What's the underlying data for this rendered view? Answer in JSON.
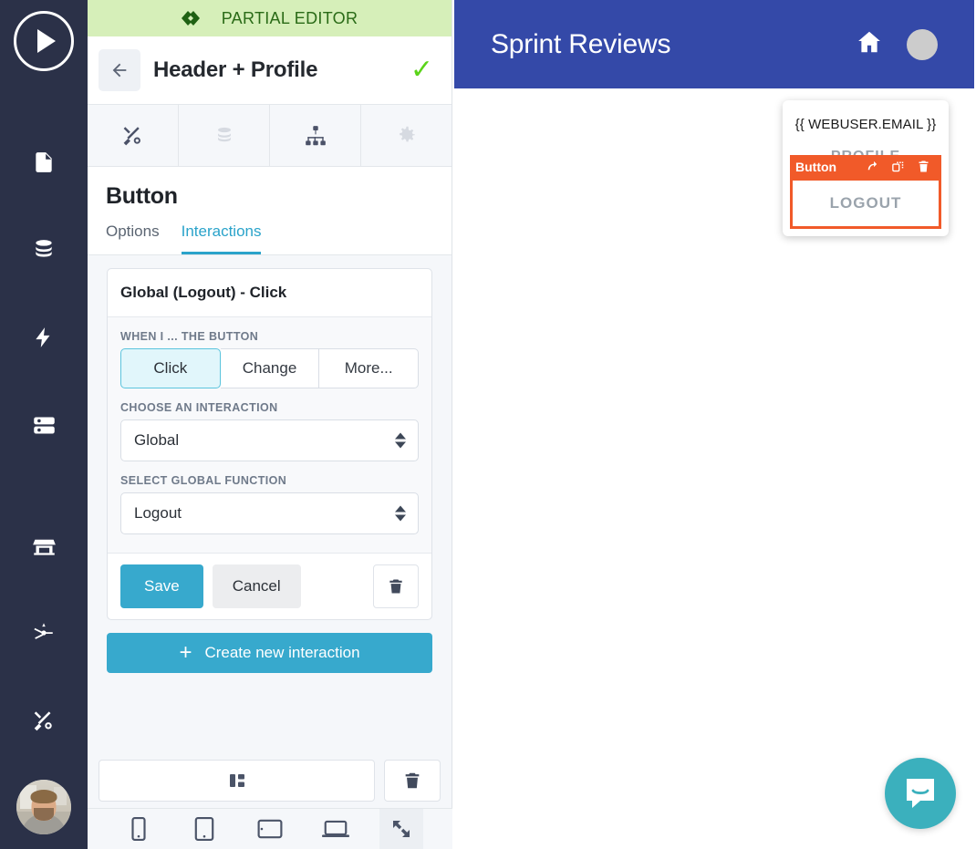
{
  "rail": {
    "logo_icon": "play-circle-icon",
    "items": [
      {
        "icon": "page-icon",
        "name": "pages"
      },
      {
        "icon": "database-icon",
        "name": "data"
      },
      {
        "icon": "lightning-icon",
        "name": "actions"
      },
      {
        "icon": "server-icon",
        "name": "servers"
      },
      {
        "icon": "storefront-icon",
        "name": "marketplace"
      },
      {
        "icon": "share-icon",
        "name": "integrations"
      },
      {
        "icon": "tools-icon",
        "name": "settings"
      }
    ],
    "avatar_name": "user-avatar"
  },
  "editor": {
    "banner": {
      "label": "PARTIAL EDITOR",
      "icon": "partial-diamond-icon"
    },
    "title": "Header + Profile",
    "back_icon": "arrow-left-icon",
    "saved_icon": "check-icon",
    "tabs": [
      {
        "icon": "tools-icon",
        "name": "build",
        "active": true
      },
      {
        "icon": "database-icon",
        "name": "data",
        "active": false
      },
      {
        "icon": "sitemap-icon",
        "name": "structure",
        "active": true
      },
      {
        "icon": "gear-icon",
        "name": "settings",
        "active": false
      }
    ],
    "component_name": "Button",
    "sub_tabs": [
      {
        "label": "Options",
        "active": false
      },
      {
        "label": "Interactions",
        "active": true
      }
    ],
    "interaction": {
      "card_title": "Global (Logout) - Click",
      "trigger_label": "WHEN I ... THE BUTTON",
      "triggers": [
        {
          "label": "Click",
          "selected": true
        },
        {
          "label": "Change",
          "selected": false
        },
        {
          "label": "More...",
          "selected": false
        }
      ],
      "interaction_label": "CHOOSE AN INTERACTION",
      "interaction_value": "Global",
      "interaction_options": [
        "Global"
      ],
      "function_label": "SELECT GLOBAL FUNCTION",
      "function_value": "Logout",
      "function_options": [
        "Logout"
      ],
      "save_label": "Save",
      "cancel_label": "Cancel",
      "delete_icon": "trash-icon"
    },
    "create_label": "Create new interaction",
    "create_plus": "+",
    "bottom": {
      "layout_icon": "layout-columns-icon",
      "delete_icon": "trash-icon"
    },
    "devices": [
      {
        "icon": "mobile-icon",
        "name": "mobile",
        "active": false
      },
      {
        "icon": "tablet-portrait-icon",
        "name": "tablet-portrait",
        "active": false
      },
      {
        "icon": "tablet-landscape-icon",
        "name": "tablet-landscape",
        "active": false
      },
      {
        "icon": "laptop-icon",
        "name": "laptop",
        "active": false
      },
      {
        "icon": "expand-icon",
        "name": "fullscreen",
        "active": true
      }
    ]
  },
  "preview": {
    "app_bar": {
      "title": "Sprint Reviews",
      "home_icon": "home-icon",
      "avatar": "user-avatar-circle",
      "background": "#3449a8"
    },
    "popup": {
      "email": "{{ WEBUSER.EMAIL }}",
      "profile_label": "PROFILE",
      "selection": {
        "name": "Button",
        "color": "#f15a29",
        "icons": [
          {
            "icon": "move-arrow-icon",
            "name": "move"
          },
          {
            "icon": "duplicate-icon",
            "name": "duplicate"
          },
          {
            "icon": "trash-icon",
            "name": "delete"
          }
        ]
      },
      "logout_label": "LOGOUT"
    },
    "chat_icon": "chat-bubble-icon"
  },
  "colors": {
    "rail_bg": "#2b3148",
    "banner_bg": "#d6efb9",
    "banner_text": "#2a6b17",
    "accent": "#37a9cd",
    "selection": "#f15a29",
    "app_bar": "#3449a8",
    "chat": "#3bb0bd"
  }
}
